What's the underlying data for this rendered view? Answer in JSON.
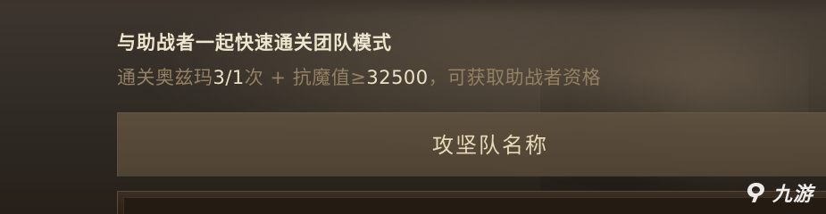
{
  "mode": {
    "title": "与助战者一起快速通关团队模式"
  },
  "requirement": {
    "prefix": "通关奥兹玛",
    "clear_count": "3/1",
    "times_unit": "次 + 抗魔值≥",
    "anti_magic_value": "32500",
    "suffix": "，可获取助战者资格"
  },
  "team": {
    "name_label": "攻坚队名称"
  },
  "watermark": {
    "text": "九游",
    "icon": "jiuyou-logo-icon"
  },
  "colors": {
    "title": "#efe6cf",
    "muted_text": "#948062",
    "highlight_text": "#ede0c2",
    "button_bg": "#5f503e"
  }
}
